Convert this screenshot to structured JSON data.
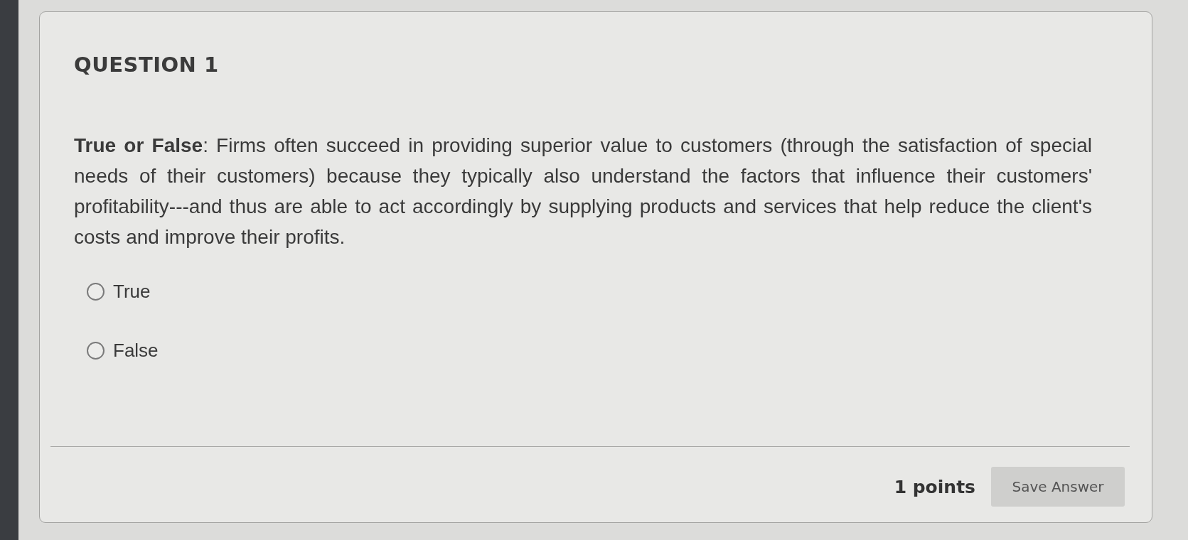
{
  "question": {
    "title": "QUESTION 1",
    "text": "**True or False**: Firms often succeed in providing superior value to customers (through the satisfaction of special needs of their customers) because they typically also understand the factors that influence their customers' profitability---and thus are able to act accordingly by supplying products and services that help reduce the client's costs and improve their profits.",
    "options": [
      {
        "label": "True",
        "selected": false
      },
      {
        "label": "False",
        "selected": false
      }
    ]
  },
  "footer": {
    "points": "1 points",
    "save_button": "Save Answer"
  }
}
